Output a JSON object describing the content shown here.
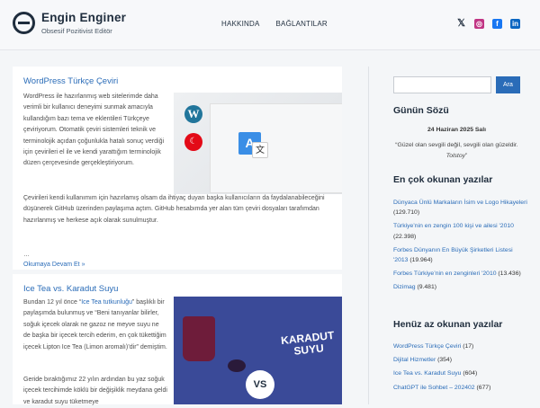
{
  "site": {
    "title": "Engin Enginer",
    "tagline": "Obsesif Pozitivist Editör"
  },
  "nav": [
    {
      "label": "HAKKINDA"
    },
    {
      "label": "BAĞLANTILAR"
    }
  ],
  "social": [
    {
      "name": "x-icon",
      "glyph": "𝕏"
    },
    {
      "name": "instagram-icon",
      "glyph": "◎"
    },
    {
      "name": "facebook-icon",
      "glyph": "f"
    },
    {
      "name": "linkedin-icon",
      "glyph": "in"
    }
  ],
  "posts": [
    {
      "title": "WordPress Türkçe Çeviri",
      "para1": "WordPress ile hazırlanmış web sitelerimde daha verimli bir kullanıcı deneyimi sunmak amacıyla kullandığım bazı tema ve eklentileri Türkçeye çeviriyorum. Otomatik çeviri sistemleri teknik ve terminolojik açıdan çoğunlukla hatalı sonuç verdiği için çevirileri el ile ve kendi yarattığım terminolojik düzen çerçevesinde gerçekleştiriyorum.",
      "para2": "Çevirileri kendi kullanımım için hazırlamış olsam da ihtiyaç duyan başka kullanıcıların da faydalanabileceğini düşünerek GitHub üzerinden paylaşıma açtım. GitHub hesabımda yer alan tüm çeviri dosyaları tarafımdan hazırlanmış ve herkese açık olarak sunulmuştur.",
      "ellipsis": "…",
      "read_more": "Okumaya Devam Et »"
    },
    {
      "title": "Ice Tea vs. Karadut Suyu",
      "para1_pre": "Bundan 12 yıl önce “",
      "para1_link": "Ice Tea tutkunluğu",
      "para1_post": "” başlıklı bir paylaşımda bulunmuş ve “Beni tanıyanlar bilirler, soğuk içecek olarak ne gazoz ne meyve suyu ne de başka bir içecek tercih ederim, en çok tükettiğim içecek Lipton Ice Tea (Limon aromalı)’dir” demiştim.",
      "para2": "Geride bıraktığımız 22 yılın ardından bu yaz soğuk içecek tercihimde köklü bir değişiklik meydana geldi ve karadut suyu tüketmeye",
      "image_text": "KARADUT SUYU",
      "vs": "VS"
    }
  ],
  "search": {
    "placeholder": "",
    "button": "Ara"
  },
  "quote": {
    "heading": "Günün Sözü",
    "date": "24 Haziran 2025 Salı",
    "text": "“Güzel olan sevgili değil, sevgili olan güzeldir.",
    "author": "Tolstoy",
    "close": "”"
  },
  "most_read": {
    "heading": "En çok okunan yazılar",
    "items": [
      {
        "title": "Dünyaca Ünlü Markaların İsim ve Logo Hikayeleri",
        "count": "(129.710)"
      },
      {
        "title": "Türkiye’nin en zengin 100 kişi ve ailesi '2010",
        "count": "(22.398)"
      },
      {
        "title": "Forbes Dünyanın En Büyük Şirketleri Listesi '2013",
        "count": "(19.964)"
      },
      {
        "title": "Forbes Türkiye’nin en zenginleri '2010",
        "count": "(13.436)"
      },
      {
        "title": "Dizimag",
        "count": "(9.481)"
      }
    ]
  },
  "least_read": {
    "heading": "Henüz az okunan yazılar",
    "items": [
      {
        "title": "WordPress Türkçe Çeviri",
        "count": "(17)"
      },
      {
        "title": "Dijital Hizmetler",
        "count": "(354)"
      },
      {
        "title": "Ice Tea vs. Karadut Suyu",
        "count": "(604)"
      },
      {
        "title": "ChatGPT ile Sohbet – 202402",
        "count": "(677)"
      }
    ]
  },
  "colors": {
    "accent": "#2a6cb8",
    "dark": "#1f2d3d",
    "background": "#f4f6f8"
  }
}
